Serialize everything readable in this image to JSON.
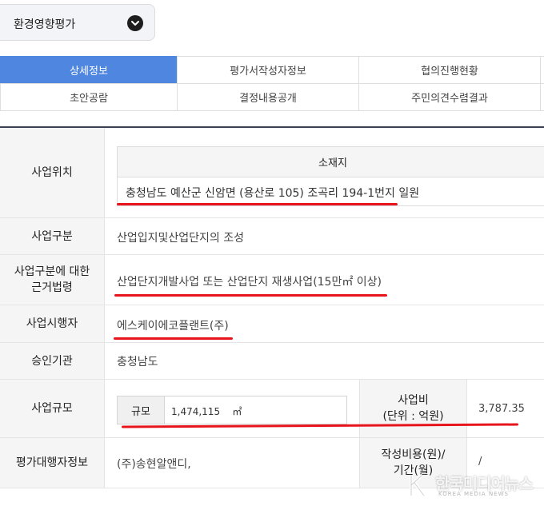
{
  "category": {
    "label": "환경영향평가",
    "icon": "chevron-down-icon"
  },
  "tabs": {
    "row1": [
      "상세정보",
      "평가서작성자정보",
      "협의진행현황"
    ],
    "row2": [
      "초안공람",
      "결정내용공개",
      "주민의견수렴결과"
    ],
    "active": "상세정보"
  },
  "details": {
    "location": {
      "label": "사업위치",
      "column_header": "소재지",
      "address": "충청남도 예산군 신암면 (용산로 105) 조곡리 194-1번지 일원"
    },
    "type": {
      "label": "사업구분",
      "value": "산업입지및산업단지의 조성"
    },
    "legal_basis": {
      "label_line1": "사업구분에 대한",
      "label_line2": "근거법령",
      "value": "산업단지개발사업 또는 산업단지 재생사업(15만㎡ 이상)"
    },
    "operator": {
      "label": "사업시행자",
      "value": "에스케이에코플랜트(주)"
    },
    "approval": {
      "label": "승인기관",
      "value": "충청남도"
    },
    "scale": {
      "label": "사업규모",
      "key": "규모",
      "value": "1,474,115",
      "unit": "㎡",
      "cost_label_line1": "사업비",
      "cost_label_line2": "(단위 : 억원)",
      "cost_value": "3,787.35"
    },
    "agency": {
      "label": "평가대행자정보",
      "value": "(주)송현알앤디,",
      "cost_label_line1": "작성비용(원)/",
      "cost_label_line2": "기간(월)",
      "cost_value": "/"
    }
  },
  "watermark": {
    "text": "한국미디어뉴스",
    "sub": "KOREA MEDIA NEWS"
  },
  "colors": {
    "active_tab": "#4e86e0",
    "highlight_underline": "#e8141c",
    "header_bg": "#f5f5f5"
  }
}
